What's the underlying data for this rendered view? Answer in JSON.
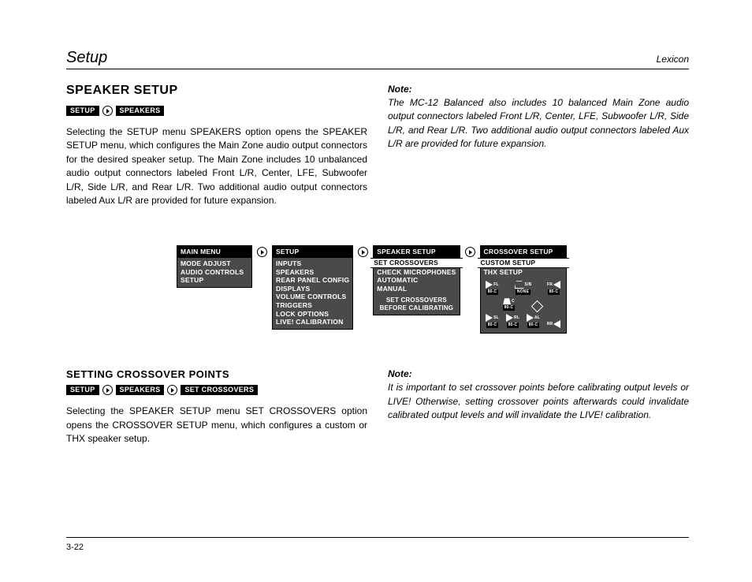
{
  "header": {
    "left": "Setup",
    "right": "Lexicon"
  },
  "speaker_setup": {
    "title": "SPEAKER SETUP",
    "crumbs": [
      "SETUP",
      "SPEAKERS"
    ],
    "body": "Selecting the SETUP menu SPEAKERS option opens the SPEAKER SETUP menu, which configures the Main Zone audio output connectors for the desired speaker setup. The Main Zone includes 10 unbalanced audio output connectors labeled Front L/R, Center, LFE, Subwoofer L/R, Side L/R, and Rear L/R. Two additional audio output connectors labeled Aux L/R are provided for future expansion.",
    "note_h": "Note:",
    "note": "The MC-12 Balanced also includes 10 balanced Main Zone audio output connectors labeled Front L/R, Center, LFE, Subwoofer L/R, Side L/R, and Rear L/R. Two additional audio output connectors labeled Aux L/R are provided for future expansion."
  },
  "menus": {
    "main": {
      "title": "MAIN MENU",
      "items": [
        "MODE ADJUST",
        "AUDIO CONTROLS",
        "SETUP"
      ]
    },
    "setup": {
      "title": "SETUP",
      "items": [
        "INPUTS",
        "SPEAKERS",
        "REAR PANEL CONFIG",
        "DISPLAYS",
        "VOLUME CONTROLS",
        "TRIGGERS",
        "LOCK OPTIONS",
        "LIVE! CALIBRATION"
      ]
    },
    "spk": {
      "title": "SPEAKER SETUP",
      "items": [
        "SET CROSSOVERS",
        "CHECK MICROPHONES",
        "AUTOMATIC",
        "MANUAL"
      ],
      "hint1": "SET CROSSOVERS",
      "hint2": "BEFORE CALIBRATING"
    },
    "xover": {
      "title": "CROSSOVER SETUP",
      "items": [
        "CUSTOM SETUP",
        "THX SETUP"
      ],
      "spk_cells": {
        "fl": {
          "side": "FL",
          "chip": "80-C"
        },
        "sub": {
          "side": "S/B",
          "chip": "NONE"
        },
        "fr": {
          "side": "FR",
          "chip": "80-C"
        },
        "c": {
          "side": "C",
          "chip": "80-C"
        },
        "lfe": {
          "side": "",
          "chip": ""
        },
        "sl": {
          "side": "SL",
          "chip": "80-C"
        },
        "rl": {
          "side": "RL",
          "chip": "80-C"
        },
        "al": {
          "side": "AL",
          "chip": "80-C"
        },
        "rr": {
          "side": "RR",
          "chip": ""
        }
      }
    }
  },
  "crossover_section": {
    "title": "SETTING CROSSOVER POINTS",
    "crumbs": [
      "SETUP",
      "SPEAKERS",
      "SET CROSSOVERS"
    ],
    "body": "Selecting the SPEAKER SETUP menu SET CROSSOVERS option opens the CROSSOVER SETUP menu, which configures a custom or THX speaker setup.",
    "note_h": "Note:",
    "note": "It is important to set crossover points before calibrating output levels or LIVE! Otherwise, setting crossover points afterwards could invalidate calibrated output levels and will invalidate the LIVE! calibration."
  },
  "footer": {
    "page": "3-22"
  }
}
